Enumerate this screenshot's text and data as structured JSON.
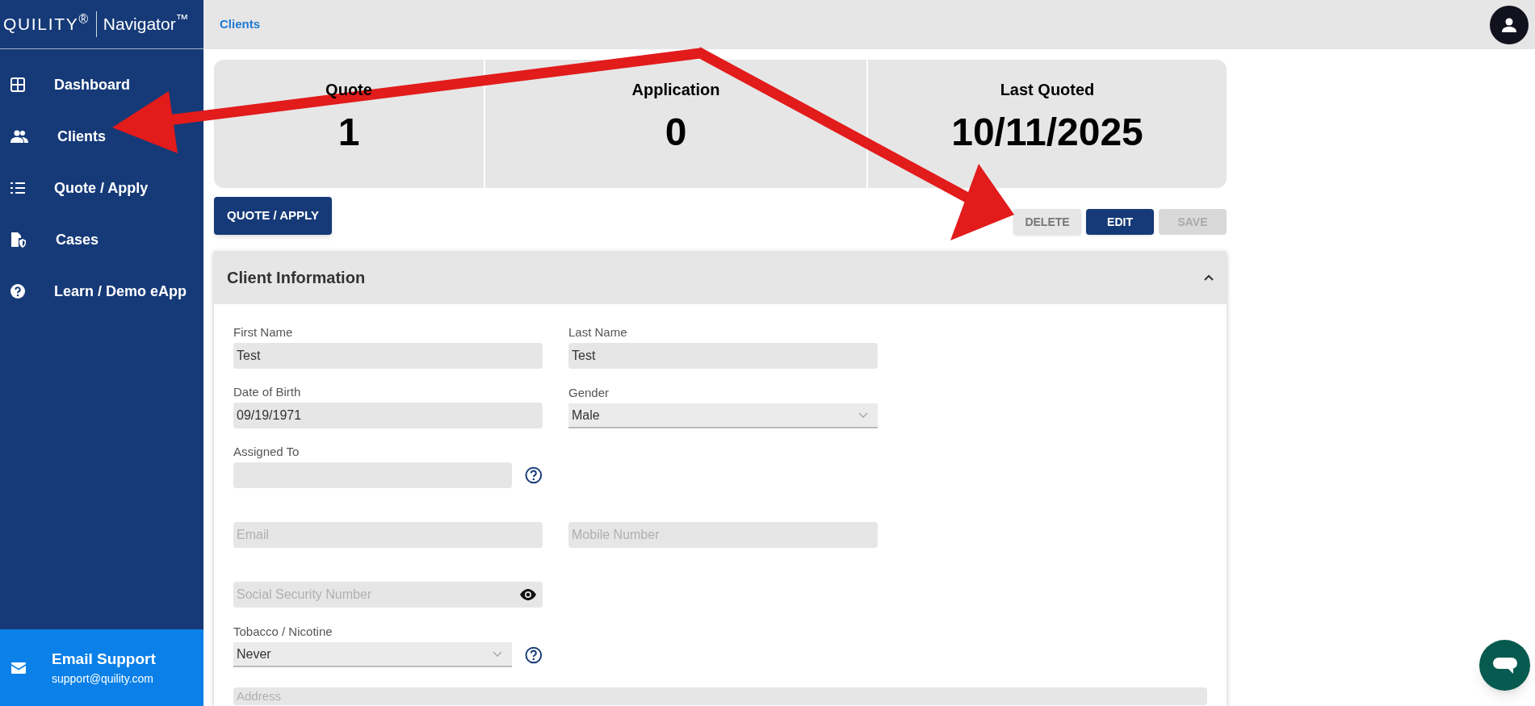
{
  "logo": {
    "brand": "QUILITY$^{®}$",
    "product": "Navigator$^{™}$"
  },
  "sidebar": {
    "items": [
      {
        "label": "Dashboard"
      },
      {
        "label": "Clients"
      },
      {
        "label": "Quote / Apply"
      },
      {
        "label": "Cases"
      },
      {
        "label": "Learn / Demo eApp"
      }
    ],
    "support": {
      "title": "Email Support",
      "email": "support@quility.com"
    }
  },
  "breadcrumb": "Clients",
  "stats": [
    {
      "label": "Quote",
      "value": "1"
    },
    {
      "label": "Application",
      "value": "0"
    },
    {
      "label": "Last Quoted",
      "value": "10/11/2025"
    }
  ],
  "primary_button": "QUOTE / APPLY",
  "actions": [
    {
      "label": "DELETE",
      "kind": "light",
      "disabled": false
    },
    {
      "label": "EDIT",
      "kind": "dark",
      "disabled": false
    },
    {
      "label": "SAVE",
      "kind": "light",
      "disabled": true
    }
  ],
  "panel": {
    "title": "Client Information",
    "expanded": true,
    "rows": [
      [
        {
          "kind": "text",
          "label": "First Name",
          "value": "Test"
        },
        {
          "kind": "text",
          "label": "Last Name",
          "value": "Test"
        }
      ],
      [
        {
          "kind": "text",
          "label": "Date of Birth",
          "value": "09/19/1971"
        },
        {
          "kind": "select",
          "label": "Gender",
          "value": "Male"
        }
      ],
      [
        {
          "kind": "text",
          "label": "Assigned To",
          "help": true
        }
      ],
      [
        {
          "kind": "text",
          "placeholder": "Email"
        },
        {
          "kind": "text",
          "placeholder": "Mobile Number"
        }
      ],
      [
        {
          "kind": "secret",
          "placeholder": "Social Security Number"
        }
      ],
      [
        {
          "kind": "select",
          "label": "Tobacco / Nicotine",
          "value": "Never",
          "help": true
        }
      ],
      [
        {
          "kind": "wide",
          "placeholder": "Address"
        }
      ]
    ]
  }
}
